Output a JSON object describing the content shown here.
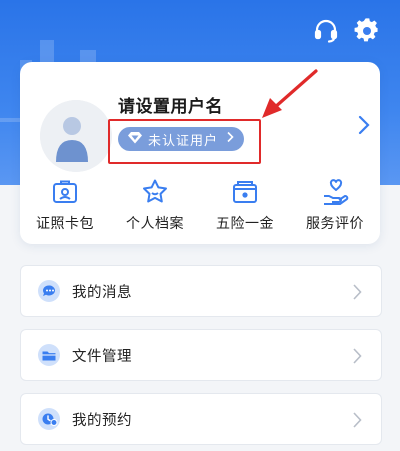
{
  "header": {
    "support_icon": "headset-icon",
    "settings_icon": "gear-icon",
    "background_color": "#2a74e8"
  },
  "profile": {
    "username_prompt": "请设置用户名",
    "verify_status": "未认证用户",
    "verify_badge_icon": "diamond-icon",
    "avatar_icon": "user-avatar-icon",
    "highlight_color": "#e02a2a"
  },
  "shortcuts": [
    {
      "label": "证照卡包",
      "icon": "id-card-icon"
    },
    {
      "label": "个人档案",
      "icon": "star-face-icon"
    },
    {
      "label": "五险一金",
      "icon": "wallet-icon"
    },
    {
      "label": "服务评价",
      "icon": "heart-hand-icon"
    }
  ],
  "menu": [
    {
      "label": "我的消息",
      "icon": "message-icon"
    },
    {
      "label": "文件管理",
      "icon": "folder-icon"
    },
    {
      "label": "我的预约",
      "icon": "appointment-icon"
    }
  ],
  "accent_color": "#3a7ef0"
}
